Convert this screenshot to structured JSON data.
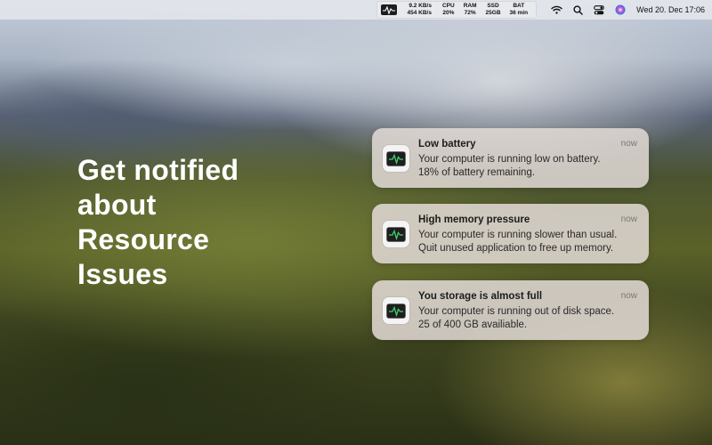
{
  "menubar": {
    "stats": {
      "net_down": "9.2 KB/s",
      "net_up": "454 KB/s",
      "cpu_label": "CPU",
      "cpu_value": "20%",
      "ram_label": "RAM",
      "ram_value": "72%",
      "ssd_label": "SSD",
      "ssd_value": "25GB",
      "bat_label": "BAT",
      "bat_value": "36 min",
      "icon": "activity-monitor-icon"
    },
    "icons": [
      "wifi-icon",
      "search-icon",
      "control-center-icon",
      "siri-icon"
    ],
    "clock": "Wed 20. Dec 17:06"
  },
  "headline": {
    "lines": [
      "Get notified",
      "about",
      "Resource",
      "Issues"
    ]
  },
  "notifications": [
    {
      "title": "Low battery",
      "time": "now",
      "body": [
        "Your computer is running low on battery.",
        "18% of battery remaining."
      ],
      "icon": "activity-monitor-icon"
    },
    {
      "title": "High memory pressure",
      "time": "now",
      "body": [
        "Your computer is running slower than usual.",
        "Quit unused application to free up memory."
      ],
      "icon": "activity-monitor-icon"
    },
    {
      "title": "You storage is almost full",
      "time": "now",
      "body": [
        "Your computer is running out of disk space.",
        "25 of 400 GB availiable."
      ],
      "icon": "activity-monitor-icon"
    }
  ],
  "colors": {
    "menubar_bg": "#e8eaee",
    "notification_bg": "#e2dad6",
    "headline": "#ffffff"
  }
}
